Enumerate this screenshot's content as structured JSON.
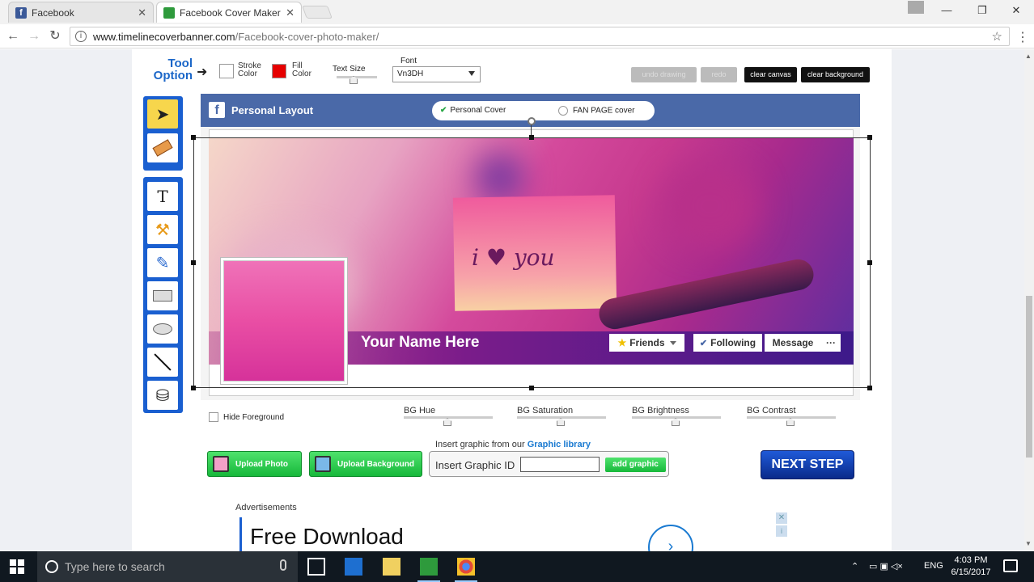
{
  "browser": {
    "tabs": [
      {
        "label": "Facebook"
      },
      {
        "label": "Facebook Cover Maker | "
      }
    ],
    "address": {
      "host": "www.timelinecoverbanner.com",
      "path": "/Facebook-cover-photo-maker/"
    }
  },
  "tool_option": {
    "title_line1": "Tool",
    "title_line2": "Option",
    "stroke_label_1": "Stroke",
    "stroke_label_2": "Color",
    "fill_label_1": "Fill",
    "fill_label_2": "Color",
    "text_size_label": "Text Size",
    "font_label": "Font",
    "font_value": "Vn3DH",
    "stroke_color": "#ffffff",
    "fill_color": "#e60000",
    "buttons": {
      "undo": "undo drawing",
      "redo": "redo",
      "clear_canvas": "clear canvas",
      "clear_background": "clear background"
    }
  },
  "canvas": {
    "layout_title": "Personal Layout",
    "option_personal": "Personal Cover",
    "option_fanpage": "FAN PAGE cover",
    "card_text": "i ♥ you",
    "your_name": "Your Name Here",
    "fb_buttons": {
      "friends": "Friends",
      "following": "Following",
      "message": "Message",
      "more": "···"
    }
  },
  "adjustments": {
    "hide_foreground": "Hide Foreground",
    "bg_hue": "BG Hue",
    "bg_saturation": "BG Saturation",
    "bg_brightness": "BG Brightness",
    "bg_contrast": "BG Contrast"
  },
  "actions": {
    "upload_photo": "Upload  Photo",
    "upload_background": "Upload Background",
    "insert_from": "Insert graphic from our ",
    "graphic_library": "Graphic library",
    "insert_graphic_id": "Insert Graphic ID",
    "add_graphic": "add graphic",
    "next_step": "NEXT STEP"
  },
  "ads": {
    "label": "Advertisements",
    "headline": "Free Download"
  },
  "taskbar": {
    "search_placeholder": "Type here to search",
    "lang": "ENG",
    "time": "4:03 PM",
    "date": "6/15/2017"
  }
}
